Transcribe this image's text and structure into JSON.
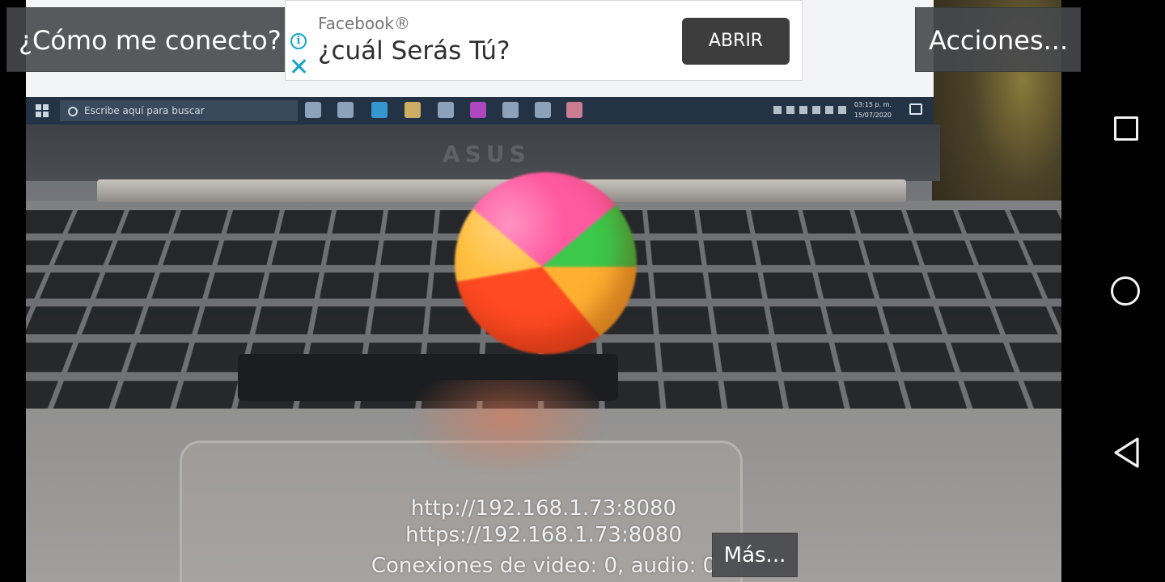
{
  "top_bar": {
    "connect_label": "¿Cómo me conecto?",
    "actions_label": "Acciones..."
  },
  "ad": {
    "source": "Facebook®",
    "headline": "¿cuál Serás Tú?",
    "cta_label": "ABRIR",
    "accent_color": "#14a6c7"
  },
  "camera": {
    "taskbar_search_placeholder": "Escribe aquí para buscar",
    "taskbar_time": "03:15 p. m.",
    "taskbar_date": "15/07/2020",
    "laptop_brand": "ASUS"
  },
  "server": {
    "http_url": "http://192.168.1.73:8080",
    "https_url": "https://192.168.1.73:8080",
    "connections": "Conexiones de video: 0, audio: 0",
    "more_label": "Más..."
  },
  "navbar": {
    "icons": [
      "recent-apps-icon",
      "home-icon",
      "back-icon"
    ]
  }
}
